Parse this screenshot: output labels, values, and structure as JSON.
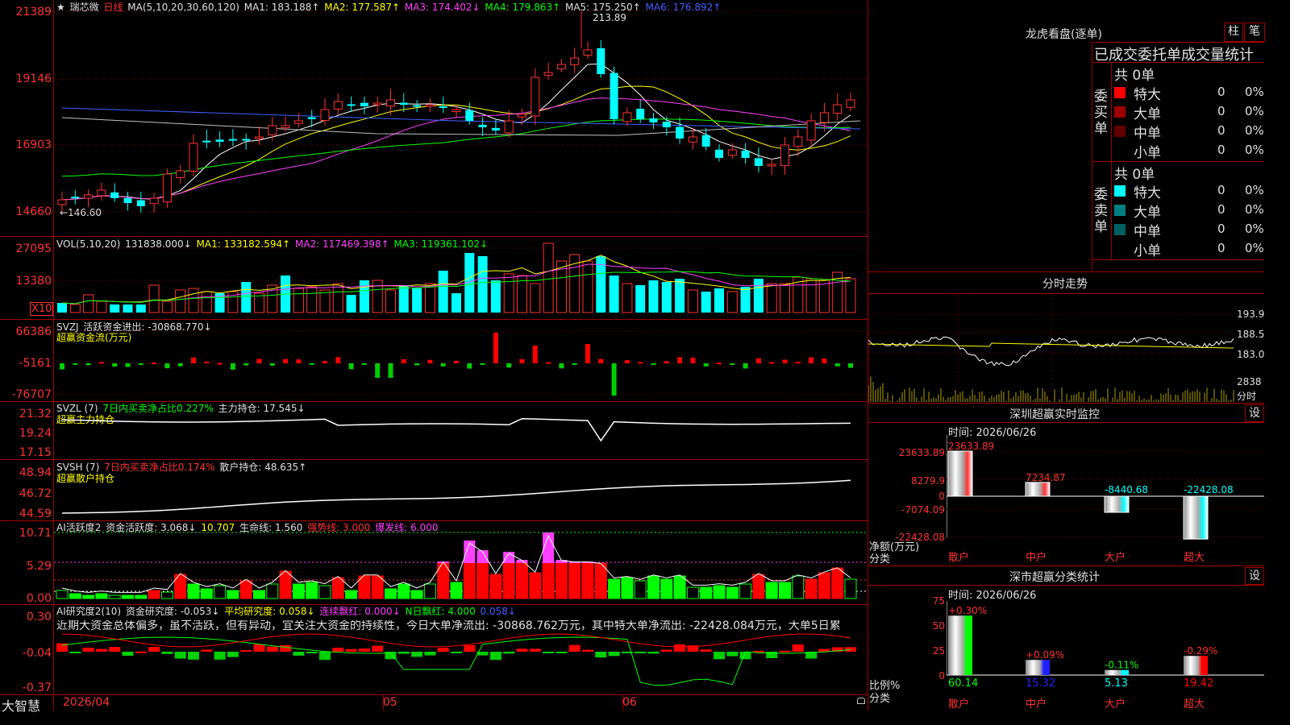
{
  "title_star": "★",
  "stock_name": "瑞芯微",
  "period": "日线",
  "ma_line": {
    "label": "MA(5,10,20,30,60,120)",
    "ma1": "MA1: 183.188↑",
    "ma2": "MA2: 177.587↑",
    "ma3": "MA3: 174.402↓",
    "ma4": "MA4: 179.863↑",
    "ma5": "MA5: 175.250↑",
    "ma6": "MA6: 176.892↑"
  },
  "price_axis": [
    "21389",
    "19146",
    "16903",
    "14660"
  ],
  "high_marker": "213.89",
  "low_marker": "←146.60",
  "vol": {
    "label": "VOL(5,10,20)",
    "v": "131838.000↓",
    "ma1": "MA1: 133182.594↑",
    "ma2": "MA2: 117469.398↑",
    "ma3": "MA3: 119361.102↓",
    "axis": [
      "27095",
      "13380"
    ],
    "unit": "X10"
  },
  "svzj": {
    "label": "SVZJ",
    "text": "活跃资金进出: -30868.770↓",
    "sub": "超赢资金流(万元)",
    "axis": [
      "66386",
      "-5161",
      "-76707"
    ]
  },
  "svzl": {
    "label": "SVZL (7)",
    "net": "7日内买卖净占比0.227%",
    "hold": "主力持仓: 17.545↓",
    "sub": "超赢主力持仓",
    "axis": [
      "21.32",
      "19.24",
      "17.15"
    ]
  },
  "svsh": {
    "label": "SVSH (7)",
    "net": "7日内买卖净占比0.174%",
    "hold": "散户持仓: 48.635↑",
    "sub": "超赢散户持仓",
    "axis": [
      "48.94",
      "46.72",
      "44.59"
    ]
  },
  "ai1": {
    "label": "AI活跃度2",
    "a": "资金活跃度: 3.068↓",
    "b": "10.707",
    "c": "生命线: 1.560",
    "d": "强势线: 3.000",
    "e": "爆发线: 6.000",
    "axis": [
      "10.71",
      "5.29",
      "0.00"
    ]
  },
  "ai2": {
    "label": "AI研究度2(10)",
    "a": "资金研究度: -0.053↓",
    "b": "平均研究度: 0.058↓",
    "c": "连续飘红: 0.000↓",
    "d": "N日飘红: 4.000",
    "e": "0.058↓",
    "axis": [
      "0.30",
      "-0.04",
      "-0.37"
    ],
    "comment": "近期大资金总体偏多，虽不活跃，但有异动，宜关注大资金的持续性，今日大单净流出: -30868.762万元，其中特大单净流出: -22428.084万元，大单5日累"
  },
  "date_axis": [
    "2026/04",
    "05",
    "06"
  ],
  "app_name": "大智慧",
  "right": {
    "lhb_title": "龙虎看盘(逐单)",
    "btn_zhu": "柱",
    "btn_bi": "笔",
    "stats_title": "已成交委托单成交量统计",
    "buy_title": "委买单",
    "sell_title": "委卖单",
    "buy_total": "共 0单",
    "sell_total": "共 0单",
    "buy_rows": [
      {
        "label": "特大",
        "v1": "0",
        "v2": "0%",
        "color": "#ff0000"
      },
      {
        "label": "大单",
        "v1": "0",
        "v2": "0%",
        "color": "#a00000"
      },
      {
        "label": "中单",
        "v1": "0",
        "v2": "0%",
        "color": "#600000"
      },
      {
        "label": "小单",
        "v1": "0",
        "v2": "0%",
        "color": "#000000"
      }
    ],
    "sell_rows": [
      {
        "label": "特大",
        "v1": "0",
        "v2": "0%",
        "color": "#00ffff"
      },
      {
        "label": "大单",
        "v1": "0",
        "v2": "0%",
        "color": "#008080"
      },
      {
        "label": "中单",
        "v1": "0",
        "v2": "0%",
        "color": "#006060"
      },
      {
        "label": "小单",
        "v1": "0",
        "v2": "0%",
        "color": "#000000"
      }
    ],
    "intraday_title": "分时走势",
    "intraday_axis": [
      "193.9",
      "188.5",
      "183.0",
      "2838",
      "分时"
    ],
    "sz_title": "深圳超赢实时监控",
    "sz_set": "设",
    "sz_time": "时间: 2026/06/26",
    "sz_axis": [
      "23633.89",
      "8279.9",
      "0",
      "-7074.09",
      "-22428.08"
    ],
    "sz_unit": "净额(万元)",
    "sz_cls": "分类",
    "sz_vals": [
      "23633.89",
      "7234.87",
      "-8440.68",
      "-22428.08"
    ],
    "cats": [
      "散户",
      "中户",
      "大户",
      "超大"
    ],
    "cls_title": "深市超赢分类统计",
    "cls_set": "设",
    "cls_time": "时间: 2026/06/26",
    "cls_axis": [
      "75",
      "50",
      "25",
      "0"
    ],
    "cls_pct": [
      "+0.30%",
      "+0.09%",
      "-0.11%",
      "-0.29%"
    ],
    "cls_vals": [
      "60.14",
      "15.32",
      "5.13",
      "19.42"
    ],
    "cls_unit": "比例%",
    "cls_cls": "分类"
  }
}
